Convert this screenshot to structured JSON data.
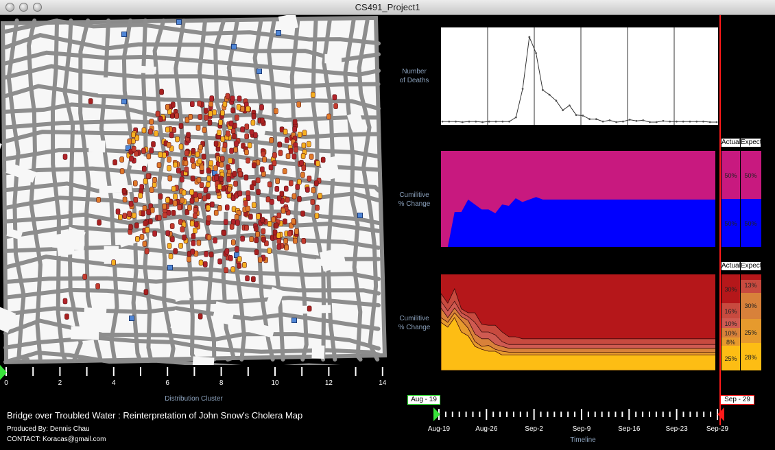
{
  "window": {
    "title": "CS491_Project1"
  },
  "map": {
    "cluster_axis": {
      "label": "Distribution Cluster",
      "ticks": [
        "0",
        "2",
        "4",
        "6",
        "8",
        "10",
        "12",
        "14"
      ]
    }
  },
  "footer": {
    "title": "Bridge over Troubled Water : Reinterpretation of John Snow's Cholera Map",
    "producer": "Produced By: Dennis Chau",
    "contact": "CONTACT: Koracas@gmail.com"
  },
  "deaths_chart": {
    "ylabel_1": "Number",
    "ylabel_2": "of Deaths"
  },
  "change_chart_1": {
    "ylabel_1": "Cumilitive",
    "ylabel_2": "% Change",
    "actual_header": "Actual",
    "expected_header": "Expect",
    "actual": [
      "50%",
      "50%"
    ],
    "expected": [
      "50%",
      "50%"
    ]
  },
  "change_chart_2": {
    "ylabel_1": "Cumilitive",
    "ylabel_2": "% Change",
    "actual_header": "Actual",
    "expected_header": "Expect",
    "actual": [
      "30%",
      "16%",
      "10%",
      "10%",
      "8%",
      "25%"
    ],
    "expected": [
      "13%",
      "30%",
      "25%",
      "28%"
    ]
  },
  "timeline": {
    "label": "Timeline",
    "start_tag": "Aug - 19",
    "end_tag": "Sep - 29",
    "ticks": [
      "Aug-19",
      "Aug-26",
      "Sep-2",
      "Sep-9",
      "Sep-16",
      "Sep-23",
      "Sep-29"
    ]
  },
  "colors": {
    "magenta": "#c8197f",
    "blue": "#0000ff",
    "red_1": "#b5171a",
    "red_2": "#c84a3f",
    "red_3": "#cf5a51",
    "orange_1": "#d8813a",
    "orange_2": "#e69a2d",
    "yellow": "#fdbd14",
    "marker_red": "#b2232a",
    "marker_yellow": "#f5b021",
    "pump_blue": "#4f86d6",
    "cursor": "#ff1a1a"
  },
  "chart_data": [
    {
      "type": "line",
      "x": [
        "Aug-19",
        "Aug-20",
        "Aug-21",
        "Aug-22",
        "Aug-23",
        "Aug-24",
        "Aug-25",
        "Aug-26",
        "Aug-27",
        "Aug-28",
        "Aug-29",
        "Aug-30",
        "Aug-31",
        "Sep-1",
        "Sep-2",
        "Sep-3",
        "Sep-4",
        "Sep-5",
        "Sep-6",
        "Sep-7",
        "Sep-8",
        "Sep-9",
        "Sep-10",
        "Sep-11",
        "Sep-12",
        "Sep-13",
        "Sep-14",
        "Sep-15",
        "Sep-16",
        "Sep-17",
        "Sep-18",
        "Sep-19",
        "Sep-20",
        "Sep-21",
        "Sep-22",
        "Sep-23",
        "Sep-24",
        "Sep-25",
        "Sep-26",
        "Sep-27",
        "Sep-28",
        "Sep-29"
      ],
      "values": [
        1,
        1,
        1,
        0,
        1,
        1,
        0,
        1,
        1,
        1,
        1,
        8,
        56,
        143,
        116,
        54,
        46,
        36,
        20,
        28,
        12,
        11,
        5,
        5,
        1,
        3,
        0,
        1,
        4,
        2,
        3,
        0,
        0,
        2,
        1,
        1,
        1,
        1,
        1,
        1,
        0,
        0
      ],
      "ylim": [
        0,
        150
      ]
    },
    {
      "type": "area",
      "series": [
        {
          "name": "",
          "values": [
            0,
            0,
            28,
            28,
            38,
            34,
            30,
            30,
            27,
            34,
            33,
            39,
            36,
            38,
            40,
            38,
            38,
            38,
            38,
            38,
            38,
            38,
            38,
            38,
            38,
            38,
            38,
            38,
            38,
            38,
            38,
            38,
            38,
            38,
            38,
            38,
            38,
            38,
            38,
            38,
            38,
            38
          ]
        }
      ],
      "ylim": [
        0,
        100
      ]
    },
    {
      "type": "area",
      "series": [
        {
          "name": "",
          "values": [
            80,
            70,
            85,
            64,
            60,
            60,
            48,
            47,
            47,
            40,
            35,
            35,
            33,
            33,
            33,
            33,
            33,
            33,
            33,
            33,
            33,
            33,
            33,
            33,
            33,
            33,
            33,
            33,
            33,
            33,
            33,
            33,
            33,
            33,
            33,
            33,
            33,
            33,
            33,
            33,
            33,
            33
          ]
        },
        {
          "name": "",
          "values": [
            72,
            62,
            72,
            60,
            56,
            50,
            40,
            40,
            37,
            30,
            27,
            27,
            27,
            27,
            27,
            27,
            27,
            27,
            27,
            27,
            27,
            27,
            27,
            27,
            27,
            27,
            27,
            27,
            27,
            27,
            27,
            27,
            27,
            27,
            27,
            27,
            27,
            27,
            27,
            27,
            27,
            27
          ]
        },
        {
          "name": "",
          "values": [
            65,
            55,
            65,
            56,
            52,
            38,
            33,
            33,
            27,
            25,
            23,
            23,
            23,
            23,
            23,
            23,
            23,
            23,
            23,
            23,
            23,
            23,
            23,
            23,
            23,
            23,
            23,
            23,
            23,
            23,
            23,
            23,
            23,
            23,
            23,
            23,
            23,
            23,
            23,
            23,
            23,
            23
          ]
        },
        {
          "name": "",
          "values": [
            55,
            50,
            60,
            52,
            44,
            30,
            25,
            26,
            22,
            20,
            19,
            19,
            19,
            19,
            19,
            19,
            19,
            19,
            19,
            19,
            19,
            19,
            19,
            19,
            19,
            19,
            19,
            19,
            19,
            19,
            19,
            19,
            19,
            19,
            19,
            19,
            19,
            19,
            19,
            19,
            19,
            19
          ]
        },
        {
          "name": "",
          "values": [
            50,
            45,
            55,
            40,
            36,
            25,
            22,
            20,
            20,
            16,
            16,
            16,
            16,
            16,
            16,
            16,
            16,
            16,
            16,
            16,
            16,
            16,
            16,
            16,
            16,
            16,
            16,
            16,
            16,
            16,
            16,
            16,
            16,
            16,
            16,
            16,
            16,
            16,
            16,
            16,
            16,
            16
          ]
        }
      ],
      "ylim": [
        0,
        100
      ]
    }
  ]
}
